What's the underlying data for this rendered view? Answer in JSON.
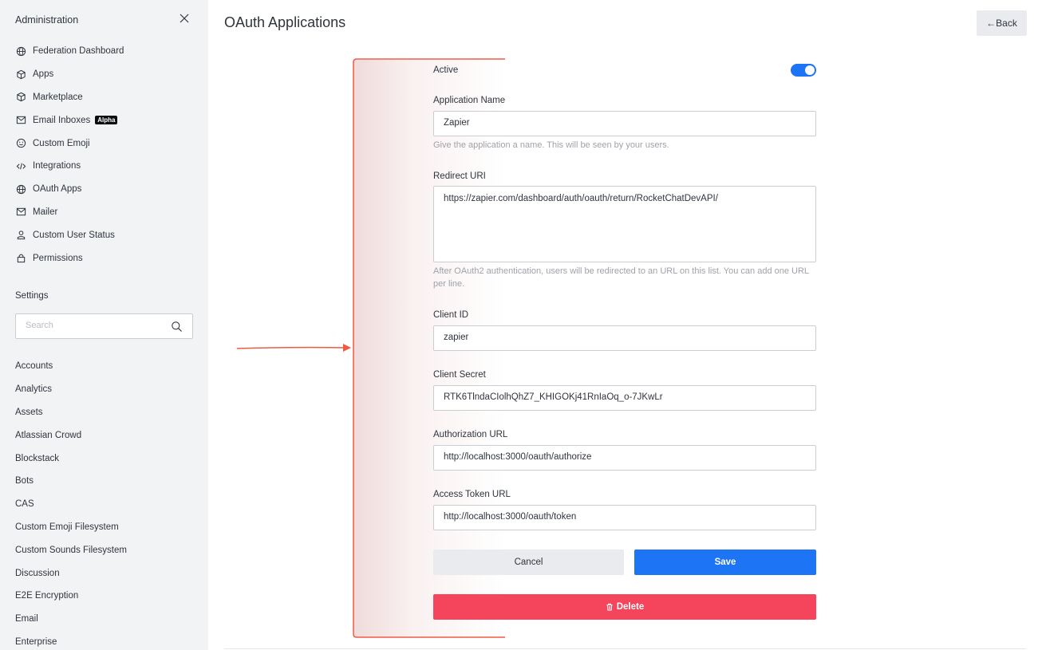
{
  "sidebar": {
    "title": "Administration",
    "close_icon": "close-icon",
    "items": [
      {
        "label": "Federation Dashboard",
        "icon": "globe-icon"
      },
      {
        "label": "Apps",
        "icon": "cube-icon"
      },
      {
        "label": "Marketplace",
        "icon": "cube-icon"
      },
      {
        "label": "Email Inboxes",
        "icon": "mail-icon",
        "badge": "Alpha"
      },
      {
        "label": "Custom Emoji",
        "icon": "emoji-icon"
      },
      {
        "label": "Integrations",
        "icon": "code-icon"
      },
      {
        "label": "OAuth Apps",
        "icon": "globe-icon"
      },
      {
        "label": "Mailer",
        "icon": "mail-icon"
      },
      {
        "label": "Custom User Status",
        "icon": "user-icon"
      },
      {
        "label": "Permissions",
        "icon": "lock-icon"
      }
    ],
    "settings_label": "Settings",
    "search_placeholder": "Search",
    "settings_items": [
      "Accounts",
      "Analytics",
      "Assets",
      "Atlassian Crowd",
      "Blockstack",
      "Bots",
      "CAS",
      "Custom Emoji Filesystem",
      "Custom Sounds Filesystem",
      "Discussion",
      "E2E Encryption",
      "Email",
      "Enterprise"
    ]
  },
  "header": {
    "title": "OAuth Applications",
    "back_label": "←Back"
  },
  "form": {
    "active_label": "Active",
    "active": true,
    "app_name_label": "Application Name",
    "app_name_value": "Zapier",
    "app_name_hint": "Give the application a name. This will be seen by your users.",
    "redirect_label": "Redirect URI",
    "redirect_value": "https://zapier.com/dashboard/auth/oauth/return/RocketChatDevAPI/",
    "redirect_hint": "After OAuth2 authentication, users will be redirected to an URL on this list. You can add one URL per line.",
    "client_id_label": "Client ID",
    "client_id_value": "zapier",
    "client_secret_label": "Client Secret",
    "client_secret_value": "RTK6TlndaCIolhQhZ7_KHIGOKj41RnIaOq_o-7JKwLr",
    "auth_url_label": "Authorization URL",
    "auth_url_value": "http://localhost:3000/oauth/authorize",
    "token_url_label": "Access Token URL",
    "token_url_value": "http://localhost:3000/oauth/token",
    "cancel_label": "Cancel",
    "save_label": "Save",
    "delete_label": "Delete"
  },
  "colors": {
    "primary": "#1d74f5",
    "danger": "#f5455c",
    "annotation": "#f05a45"
  }
}
